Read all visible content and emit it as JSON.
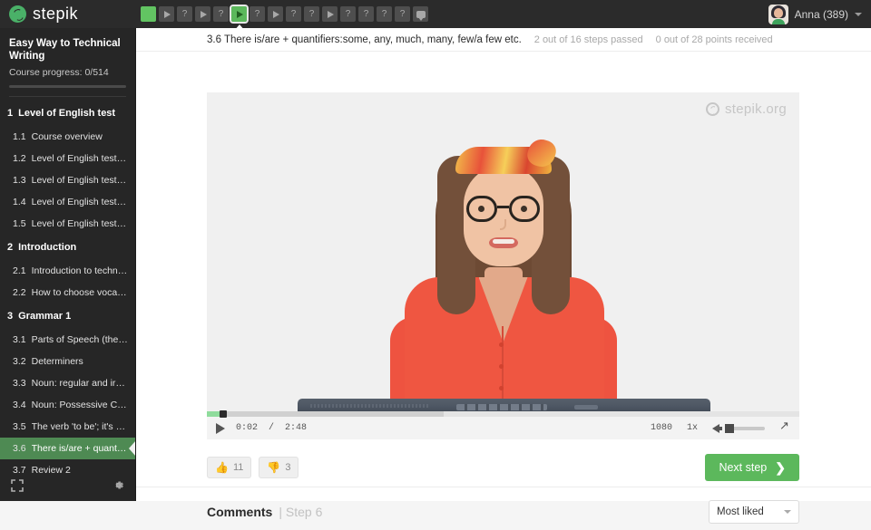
{
  "brand": {
    "name": "stepik",
    "accent": "#5cb85c",
    "watermark": "stepik.org"
  },
  "topbar": {
    "steps": [
      {
        "type": "done",
        "glyph": ""
      },
      {
        "type": "video",
        "glyph": "play"
      },
      {
        "type": "question",
        "glyph": "?"
      },
      {
        "type": "video",
        "glyph": "play"
      },
      {
        "type": "question",
        "glyph": "?"
      },
      {
        "type": "current",
        "glyph": "play"
      },
      {
        "type": "question",
        "glyph": "?"
      },
      {
        "type": "video",
        "glyph": "play"
      },
      {
        "type": "question",
        "glyph": "?"
      },
      {
        "type": "question",
        "glyph": "?"
      },
      {
        "type": "video",
        "glyph": "play"
      },
      {
        "type": "question",
        "glyph": "?"
      },
      {
        "type": "question",
        "glyph": "?"
      },
      {
        "type": "question",
        "glyph": "?"
      },
      {
        "type": "question",
        "glyph": "?"
      },
      {
        "type": "comment",
        "glyph": "bubble"
      }
    ],
    "user": {
      "name": "Anna (389)"
    }
  },
  "sidebar": {
    "course_title": "Easy Way to Technical Writing",
    "progress_label": "Course progress:  0/514",
    "progress_percent": 0,
    "toc": [
      {
        "kind": "section",
        "num": "1",
        "label": "Level of English test"
      },
      {
        "kind": "unit",
        "num": "1.1",
        "label": "Course overview"
      },
      {
        "kind": "unit",
        "num": "1.2",
        "label": "Level of English test: P..."
      },
      {
        "kind": "unit",
        "num": "1.3",
        "label": "Level of English test: P..."
      },
      {
        "kind": "unit",
        "num": "1.4",
        "label": "Level of English test: P..."
      },
      {
        "kind": "unit",
        "num": "1.5",
        "label": "Level of English test: P..."
      },
      {
        "kind": "section",
        "num": "2",
        "label": "Introduction"
      },
      {
        "kind": "unit",
        "num": "2.1",
        "label": "Introduction to technic..."
      },
      {
        "kind": "unit",
        "num": "2.2",
        "label": "How to choose vocab..."
      },
      {
        "kind": "section",
        "num": "3",
        "label": "Grammar 1"
      },
      {
        "kind": "unit",
        "num": "3.1",
        "label": "Parts of Speech (their ..."
      },
      {
        "kind": "unit",
        "num": "3.2",
        "label": "Determiners"
      },
      {
        "kind": "unit",
        "num": "3.3",
        "label": "Noun: regular and irre..."
      },
      {
        "kind": "unit",
        "num": "3.4",
        "label": "Noun: Possessive Cas..."
      },
      {
        "kind": "unit",
        "num": "3.5",
        "label": "The verb 'to be'; it's vs ..."
      },
      {
        "kind": "unit",
        "num": "3.6",
        "label": "There is/are + quantifi...",
        "active": true
      },
      {
        "kind": "unit",
        "num": "3.7",
        "label": "Review 2"
      }
    ]
  },
  "breadcrumb": {
    "title": "3.6 There is/are + quantifiers:some, any, much, many, few/a few etc.",
    "steps_passed": "2 out of 16 steps passed",
    "points_received": "0 out of 28 points  received"
  },
  "video": {
    "current_time": "0:02",
    "separator": "/",
    "duration": "2:48",
    "progress_percent": 2.5,
    "buffered_percent": 40,
    "quality": "1080",
    "speed": "1x",
    "volume_percent": 22
  },
  "actions": {
    "likes": "11",
    "dislikes": "3",
    "next_step": "Next step",
    "next_step_chevron": "❯"
  },
  "comments": {
    "title": "Comments",
    "step_label": "| Step 6",
    "sort_value": "Most liked"
  }
}
